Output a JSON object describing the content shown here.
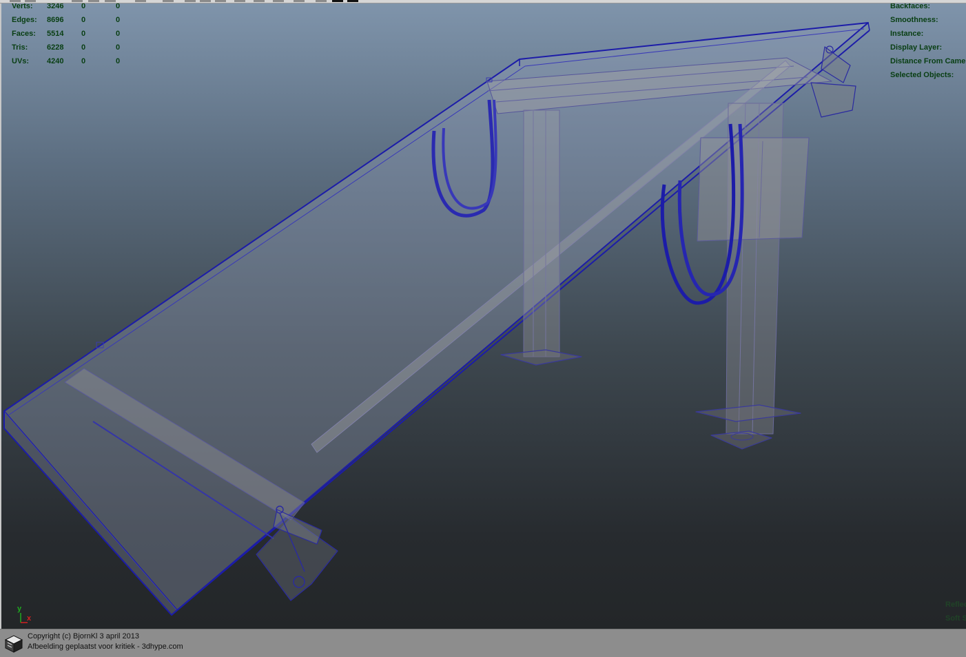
{
  "hud_stats": [
    {
      "label": "Verts:",
      "values": [
        "3246",
        "0",
        "0"
      ]
    },
    {
      "label": "Edges:",
      "values": [
        "8696",
        "0",
        "0"
      ]
    },
    {
      "label": "Faces:",
      "values": [
        "5514",
        "0",
        "0"
      ]
    },
    {
      "label": "Tris:",
      "values": [
        "6228",
        "0",
        "0"
      ]
    },
    {
      "label": "UVs:",
      "values": [
        "4240",
        "0",
        "0"
      ]
    }
  ],
  "hud_right": [
    "Backfaces:",
    "Smoothness:",
    "Instance:",
    "Display Layer:",
    "Distance From Came",
    "Selected Objects:"
  ],
  "hud_faint": [
    "Reflec",
    "Soft S"
  ],
  "axis": {
    "y": "y",
    "x": "x"
  },
  "footer": {
    "line1": "Copyright (c) BjornKl 3 april 2013",
    "line2": "Afbeelding geplaatst voor kritiek - 3dhype.com"
  },
  "colors": {
    "wire": "#1c1ca8",
    "hud_text": "#083e12",
    "axis_y": "#1faa1f",
    "axis_x": "#d42020"
  }
}
